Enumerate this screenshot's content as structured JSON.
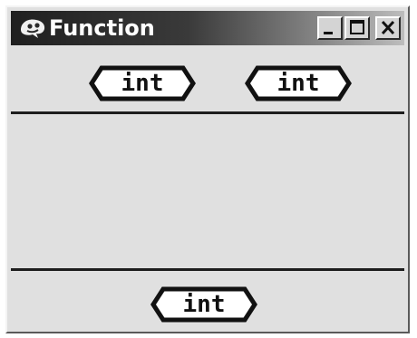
{
  "window": {
    "title": "Function",
    "icon": "function-icon",
    "controls": {
      "minimize": "minimize-icon",
      "maximize": "maximize-icon",
      "close": "close-icon"
    }
  },
  "inputs": [
    {
      "label": "int"
    },
    {
      "label": "int"
    }
  ],
  "outputs": [
    {
      "label": "int"
    }
  ],
  "colors": {
    "window_bg": "#e0e0e0",
    "tag_fill": "#ffffff",
    "tag_border": "#111111",
    "divider": "#1e1e1e"
  }
}
